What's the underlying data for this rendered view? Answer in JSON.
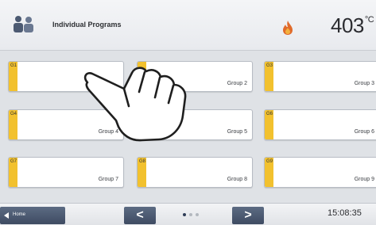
{
  "header": {
    "title": "Individual Programs",
    "temperature": "403",
    "temperature_unit": "°C",
    "icons": [
      "people-icon",
      "flame-icon"
    ]
  },
  "groups": [
    {
      "code": "G1",
      "label": ""
    },
    {
      "code": "",
      "label": "Group 2"
    },
    {
      "code": "G3",
      "label": "Group 3"
    },
    {
      "code": "G4",
      "label": "Group 4"
    },
    {
      "code": "",
      "label": "Group 5"
    },
    {
      "code": "G6",
      "label": "Group 6"
    },
    {
      "code": "G7",
      "label": "Group 7"
    },
    {
      "code": "G8",
      "label": "Group 8"
    },
    {
      "code": "G9",
      "label": "Group 9"
    }
  ],
  "footer": {
    "home_label": "Home",
    "prev_symbol": "<",
    "next_symbol": ">",
    "page_count": 3,
    "active_page": 1,
    "time": "15:08:35"
  },
  "colors": {
    "accent_stripe": "#f2c12e",
    "nav_button": "#4a5870",
    "flame": "#e06a2a"
  },
  "overlay": {
    "icon": "pointing-hand-icon"
  }
}
